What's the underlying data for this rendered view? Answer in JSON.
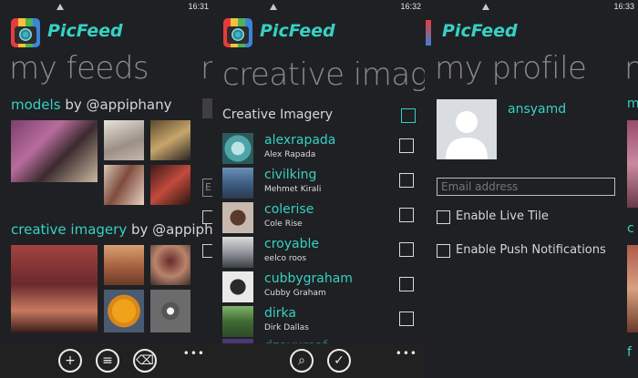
{
  "screens": [
    {
      "time": "16:31",
      "brand": "PicFeed",
      "title": "my feeds",
      "feeds": [
        {
          "name": "models",
          "by": "by @appiphany"
        },
        {
          "name": "creative imagery",
          "by": "by @appipha"
        }
      ]
    },
    {
      "time": "16:32",
      "brand": "PicFeed",
      "title": "creative image",
      "list_header": "Creative Imagery",
      "users": [
        {
          "username": "alexrapada",
          "fullname": "Alex Rapada"
        },
        {
          "username": "civilking",
          "fullname": "Mehmet Kirali"
        },
        {
          "username": "colerise",
          "fullname": "Cole Rise"
        },
        {
          "username": "croyable",
          "fullname": "eelco roos"
        },
        {
          "username": "cubbygraham",
          "fullname": "Cubby Graham"
        },
        {
          "username": "dirka",
          "fullname": "Dirk Dallas"
        },
        {
          "username": "dzoyumaf",
          "fullname": ""
        }
      ]
    },
    {
      "time": "16:33",
      "brand": "PicFeed",
      "title": "my profile",
      "username": "ansyamd",
      "email_placeholder": "Email address",
      "live_tile": "Enable Live Tile",
      "push": "Enable Push Notifications"
    }
  ],
  "peeks": {
    "s1_right_top": "r",
    "s1_right_field": "E",
    "s3_right_letters": [
      "m",
      "c",
      "f"
    ]
  },
  "icons": [
    "plus-icon",
    "filter-icon",
    "delete-icon",
    "search-icon",
    "check-icon"
  ],
  "colors": {
    "accent": "#36d1c4",
    "background": "#1f2023",
    "appbar": "#212121"
  }
}
